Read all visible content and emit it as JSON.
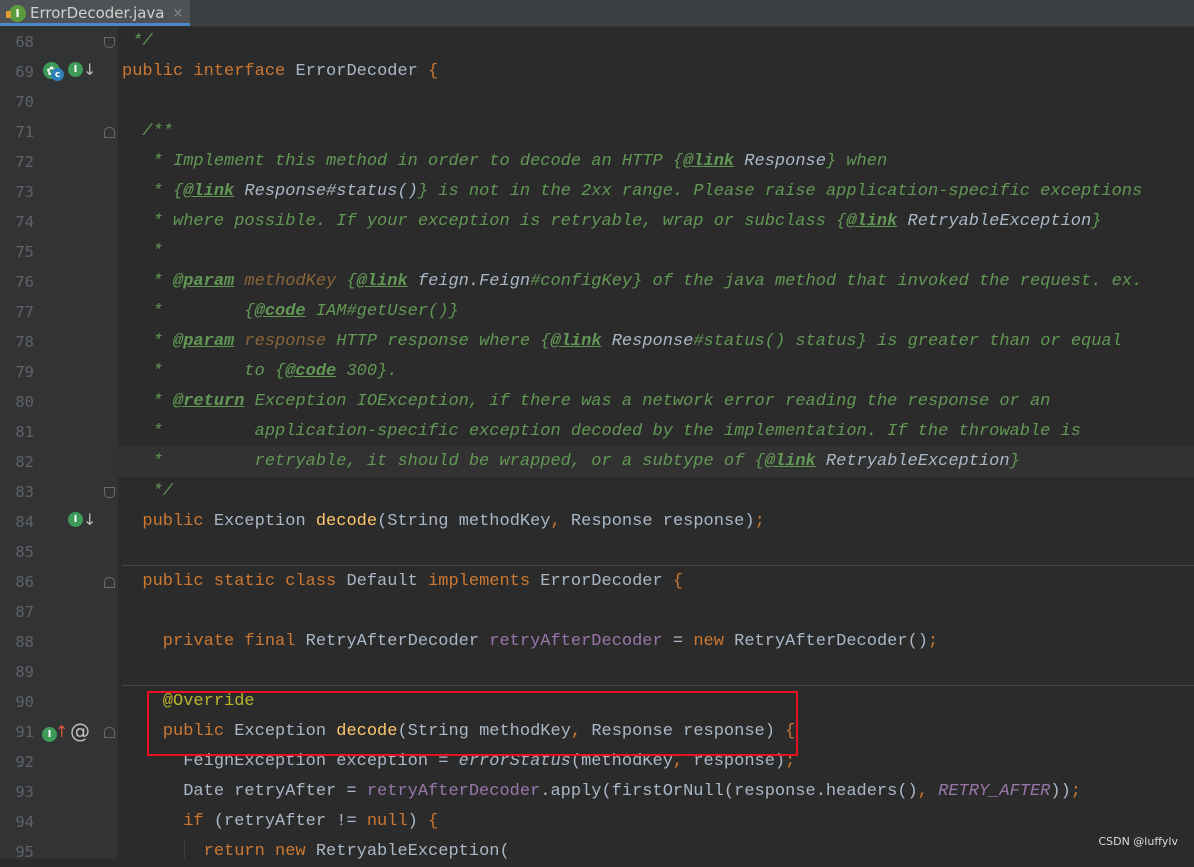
{
  "tab": {
    "title": "ErrorDecoder.java",
    "close": "×",
    "file_icon_letter": "I"
  },
  "gutter_icons": {
    "implemented_letter": "I",
    "class_letter": "c",
    "override_symbol": "@"
  },
  "highlighted_lines": [
    "90",
    "91"
  ],
  "current_line": "82",
  "lines": [
    {
      "n": "68",
      "t": [
        [
          "doc",
          " */"
        ]
      ]
    },
    {
      "n": "69",
      "t": [
        [
          "kw",
          "public "
        ],
        [
          "kw",
          "interface "
        ],
        [
          "",
          "ErrorDecoder "
        ],
        [
          "kw",
          "{"
        ]
      ]
    },
    {
      "n": "70",
      "t": []
    },
    {
      "n": "71",
      "t": [
        [
          "doc",
          "  /**"
        ]
      ]
    },
    {
      "n": "72",
      "t": [
        [
          "doc",
          "   * Implement this method in order to decode an HTTP "
        ],
        [
          "doc",
          "{"
        ],
        [
          "dtag",
          "@link"
        ],
        [
          "dref",
          " Response"
        ],
        [
          "doc",
          "}"
        ],
        [
          "doc",
          " when"
        ]
      ]
    },
    {
      "n": "73",
      "t": [
        [
          "doc",
          "   * "
        ],
        [
          "doc",
          "{"
        ],
        [
          "dtag",
          "@link"
        ],
        [
          "dref",
          " Response#status()"
        ],
        [
          "doc",
          "}"
        ],
        [
          "doc",
          " is not in the 2xx range. Please raise application-specific exceptions"
        ]
      ]
    },
    {
      "n": "74",
      "t": [
        [
          "doc",
          "   * where possible. If your exception is retryable, wrap or subclass "
        ],
        [
          "doc",
          "{"
        ],
        [
          "dtag",
          "@link"
        ],
        [
          "dref",
          " RetryableException"
        ],
        [
          "doc",
          "}"
        ]
      ]
    },
    {
      "n": "75",
      "t": [
        [
          "doc",
          "   *"
        ]
      ]
    },
    {
      "n": "76",
      "t": [
        [
          "doc",
          "   * "
        ],
        [
          "dtag",
          "@param"
        ],
        [
          "dparam",
          " methodKey "
        ],
        [
          "doc",
          "{"
        ],
        [
          "dtag",
          "@link"
        ],
        [
          "dref",
          " feign.Feign"
        ],
        [
          "doc",
          "#configKey"
        ],
        [
          "doc",
          "}"
        ],
        [
          "doc",
          " of the java method that invoked the request. ex."
        ]
      ]
    },
    {
      "n": "77",
      "t": [
        [
          "doc",
          "   *        "
        ],
        [
          "doc",
          "{"
        ],
        [
          "dtag",
          "@code"
        ],
        [
          "doc",
          " IAM#getUser()"
        ],
        [
          "doc",
          "}"
        ]
      ]
    },
    {
      "n": "78",
      "t": [
        [
          "doc",
          "   * "
        ],
        [
          "dtag",
          "@param"
        ],
        [
          "dparam",
          " response"
        ],
        [
          "doc",
          " HTTP response where "
        ],
        [
          "doc",
          "{"
        ],
        [
          "dtag",
          "@link"
        ],
        [
          "dref",
          " Response"
        ],
        [
          "doc",
          "#status() status"
        ],
        [
          "doc",
          "}"
        ],
        [
          "doc",
          " is greater than or equal"
        ]
      ]
    },
    {
      "n": "79",
      "t": [
        [
          "doc",
          "   *        to "
        ],
        [
          "doc",
          "{"
        ],
        [
          "dtag",
          "@code"
        ],
        [
          "doc",
          " 300"
        ],
        [
          "doc",
          "}"
        ],
        [
          "doc",
          "."
        ]
      ]
    },
    {
      "n": "80",
      "t": [
        [
          "doc",
          "   * "
        ],
        [
          "dtag",
          "@return"
        ],
        [
          "doc",
          " Exception IOException, if there was a network error reading the response or an"
        ]
      ]
    },
    {
      "n": "81",
      "t": [
        [
          "doc",
          "   *         application-specific exception decoded by the implementation. If the throwable is"
        ]
      ]
    },
    {
      "n": "82",
      "t": [
        [
          "doc",
          "   *         retryable, it should be wrapped, or a subtype of "
        ],
        [
          "doc",
          "{"
        ],
        [
          "dtag",
          "@link"
        ],
        [
          "dref",
          " RetryableException"
        ],
        [
          "doc",
          "}"
        ]
      ]
    },
    {
      "n": "83",
      "t": [
        [
          "doc",
          "   */"
        ]
      ]
    },
    {
      "n": "84",
      "t": [
        [
          "kw",
          "  public "
        ],
        [
          "",
          "Exception "
        ],
        [
          "fn",
          "decode"
        ],
        [
          "",
          "(String methodKey"
        ],
        [
          "kw",
          ", "
        ],
        [
          "",
          "Response response)"
        ],
        [
          "kw",
          ";"
        ]
      ]
    },
    {
      "n": "85",
      "t": []
    },
    {
      "n": "86",
      "t": [
        [
          "kw",
          "  public static class "
        ],
        [
          "",
          "Default "
        ],
        [
          "kw",
          "implements "
        ],
        [
          "",
          "ErrorDecoder "
        ],
        [
          "kw",
          "{"
        ]
      ]
    },
    {
      "n": "87",
      "t": []
    },
    {
      "n": "88",
      "t": [
        [
          "kw",
          "    private final "
        ],
        [
          "",
          "RetryAfterDecoder "
        ],
        [
          "fld",
          "retryAfterDecoder"
        ],
        [
          "",
          " = "
        ],
        [
          "kw",
          "new "
        ],
        [
          "",
          "RetryAfterDecoder()"
        ],
        [
          "kw",
          ";"
        ]
      ]
    },
    {
      "n": "89",
      "t": []
    },
    {
      "n": "90",
      "t": [
        [
          "ann",
          "    @Override"
        ]
      ]
    },
    {
      "n": "91",
      "t": [
        [
          "kw",
          "    public "
        ],
        [
          "",
          "Exception "
        ],
        [
          "fn",
          "decode"
        ],
        [
          "",
          "(String methodKey"
        ],
        [
          "kw",
          ", "
        ],
        [
          "",
          "Response response) "
        ],
        [
          "kw",
          "{"
        ]
      ]
    },
    {
      "n": "92",
      "t": [
        [
          "",
          "      FeignException exception = "
        ],
        [
          "sm",
          "errorStatus"
        ],
        [
          "",
          "(methodKey"
        ],
        [
          "kw",
          ", "
        ],
        [
          "",
          "response)"
        ],
        [
          "kw",
          ";"
        ]
      ]
    },
    {
      "n": "93",
      "t": [
        [
          "",
          "      Date retryAfter = "
        ],
        [
          "fld",
          "retryAfterDecoder"
        ],
        [
          "",
          ".apply(firstOrNull(response.headers()"
        ],
        [
          "kw",
          ", "
        ],
        [
          "sfld",
          "RETRY_AFTER"
        ],
        [
          "",
          "))"
        ],
        [
          "kw",
          ";"
        ]
      ]
    },
    {
      "n": "94",
      "t": [
        [
          "kw",
          "      if "
        ],
        [
          "",
          "(retryAfter != "
        ],
        [
          "kw",
          "null"
        ],
        [
          "",
          ") "
        ],
        [
          "kw",
          "{"
        ]
      ]
    },
    {
      "n": "95",
      "t": [
        [
          "kw",
          "        return new "
        ],
        [
          "",
          "RetryableException("
        ]
      ]
    }
  ],
  "watermark": "CSDN @luffylv"
}
